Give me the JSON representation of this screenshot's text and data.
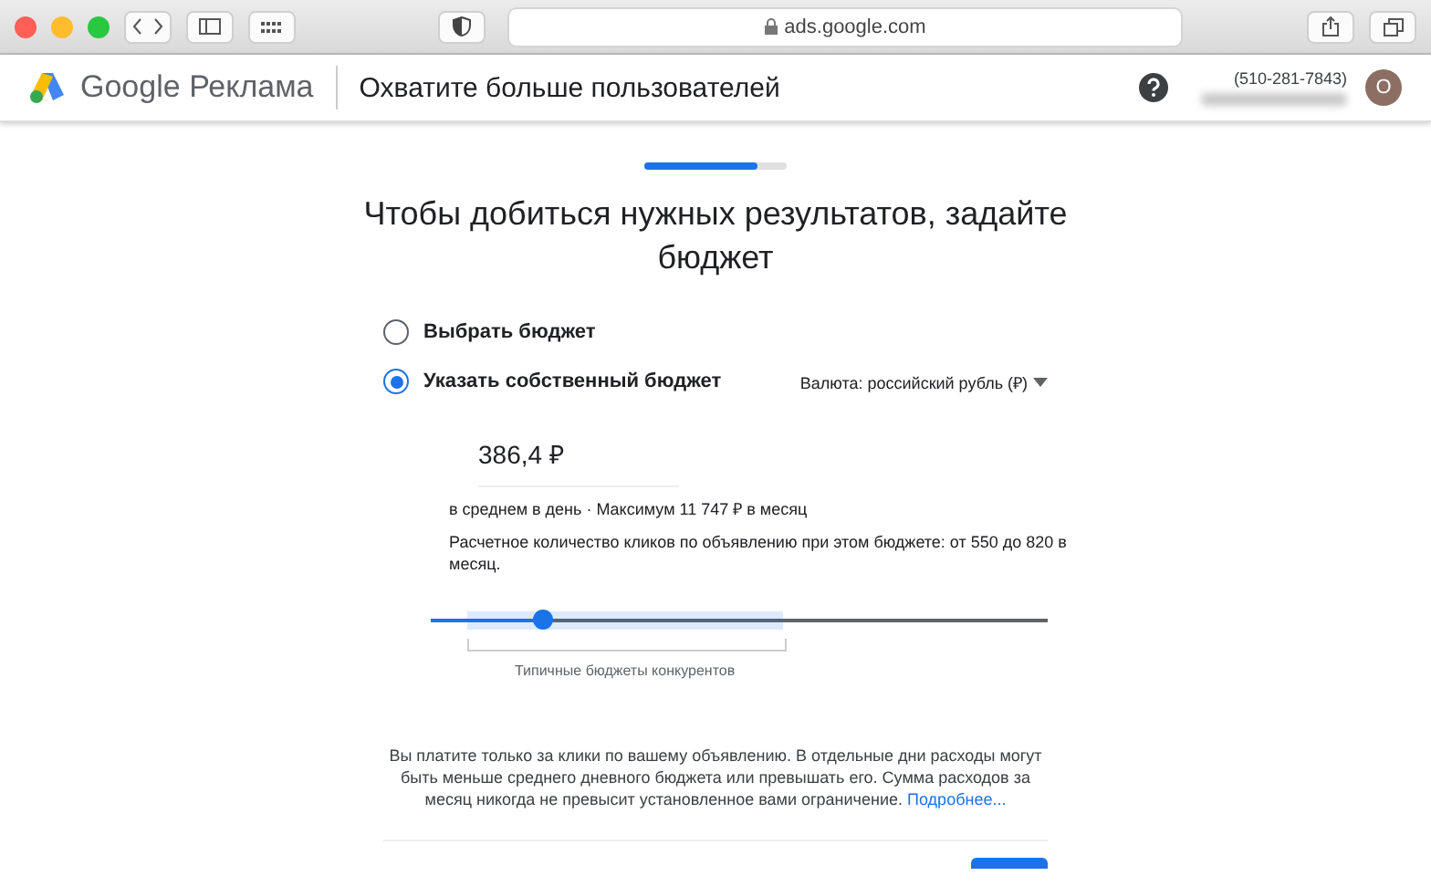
{
  "browser": {
    "url": "ads.google.com"
  },
  "header": {
    "brand": "Google",
    "product": "Реклама",
    "title": "Охватите больше пользователей",
    "phone": "(510-281-7843)",
    "avatar": "O"
  },
  "progress": {
    "level": 0.79
  },
  "heading": "Чтобы добиться нужных результатов, задайте бюджет",
  "options": [
    {
      "label": "Выбрать бюджет",
      "selected": false
    },
    {
      "label": "Указать собственный бюджет",
      "selected": true
    }
  ],
  "currency": {
    "label": "Валюта:",
    "value": "российский рубль (₽)"
  },
  "budget": {
    "amount": "386,4 ₽",
    "summary": "в среднем в день · Максимум 11 747 ₽ в месяц",
    "estimate": "Расчетное количество кликов по объявлению при этом бюджете: от 550 до 820 в месяц."
  },
  "slider": {
    "level": 0.18,
    "range_label": "Типичные бюджеты конкурентов"
  },
  "note": {
    "text": "Вы платите только за клики по вашему объявлению. В отдельные дни расходы могут быть меньше среднего дневного бюджета или превышать его. Сумма расходов за месяц никогда не превысит установленное вами ограничение.",
    "link": "Подробнее..."
  }
}
